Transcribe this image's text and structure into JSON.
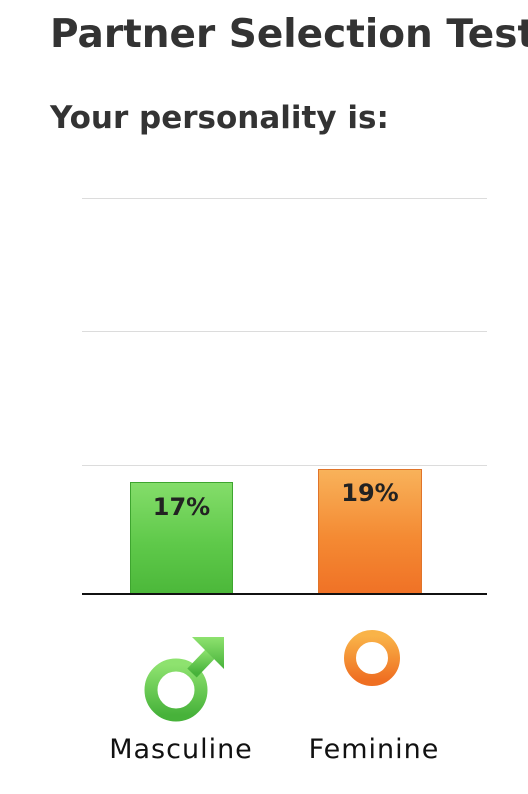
{
  "page": {
    "title": "Partner Selection Test",
    "subtitle": "Your personality is:"
  },
  "chart_data": {
    "type": "bar",
    "categories": [
      "Masculine",
      "Feminine"
    ],
    "values": [
      17,
      19
    ],
    "data_labels": [
      "17%",
      "19%"
    ],
    "ylim": [
      0,
      60
    ],
    "grid": true,
    "colors": [
      "#5fc94a",
      "#f48a33"
    ],
    "icons": [
      "male-symbol-icon",
      "female-symbol-icon"
    ]
  }
}
